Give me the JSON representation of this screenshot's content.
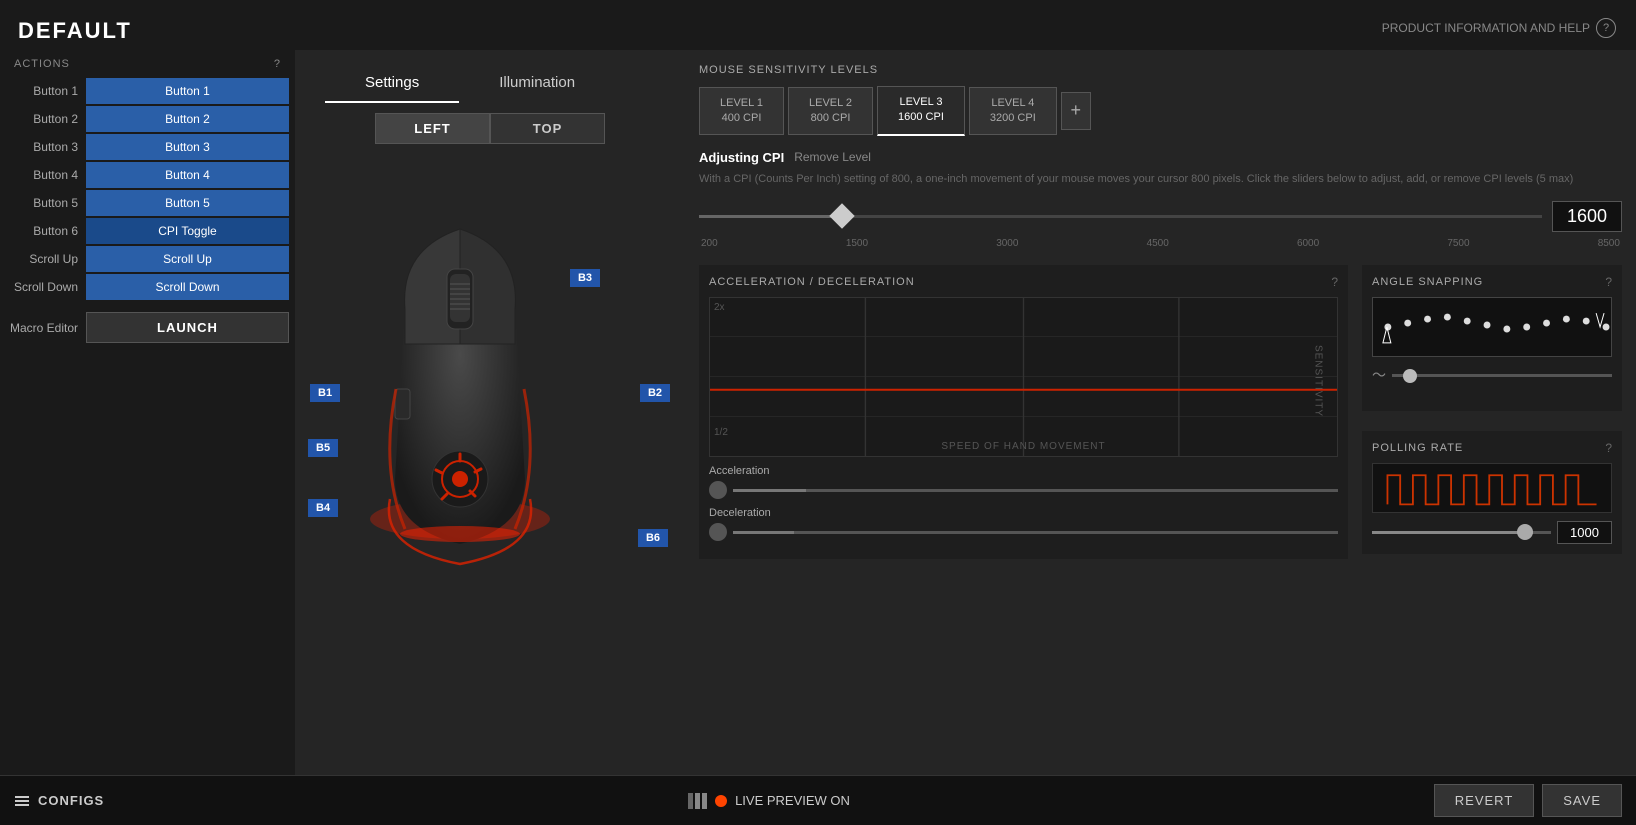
{
  "app": {
    "title": "DEFAULT",
    "product_info": "PRODUCT INFORMATION AND HELP"
  },
  "left_panel": {
    "section_title": "ACTIONS",
    "help": "?",
    "buttons": [
      {
        "label": "Button 1",
        "action": "Button 1"
      },
      {
        "label": "Button 2",
        "action": "Button 2"
      },
      {
        "label": "Button 3",
        "action": "Button 3"
      },
      {
        "label": "Button 4",
        "action": "Button 4"
      },
      {
        "label": "Button 5",
        "action": "Button 5"
      },
      {
        "label": "Button 6",
        "action": "CPI Toggle"
      },
      {
        "label": "Scroll Up",
        "action": "Scroll Up"
      },
      {
        "label": "Scroll Down",
        "action": "Scroll Down"
      }
    ],
    "macro_label": "Macro Editor",
    "launch_label": "LAUNCH"
  },
  "tabs": {
    "settings": "Settings",
    "illumination": "Illumination",
    "active": "settings"
  },
  "view_toggle": {
    "left": "LEFT",
    "top": "TOP",
    "active": "left"
  },
  "mouse_buttons": {
    "b1": "B1",
    "b2": "B2",
    "b3": "B3",
    "b4": "B4",
    "b5": "B5",
    "b6": "B6"
  },
  "sensitivity": {
    "section_title": "MOUSE SENSITIVITY LEVELS",
    "levels": [
      {
        "label": "LEVEL 1",
        "cpi": "400 CPI",
        "active": false
      },
      {
        "label": "LEVEL 2",
        "cpi": "800 CPI",
        "active": false
      },
      {
        "label": "LEVEL 3",
        "cpi": "1600 CPI",
        "active": true
      },
      {
        "label": "LEVEL 4",
        "cpi": "3200 CPI",
        "active": false
      }
    ],
    "add_label": "+",
    "adjusting_label": "Adjusting CPI",
    "remove_label": "Remove Level",
    "description": "With a CPI (Counts Per Inch) setting of 800, a one-inch movement of your mouse moves your cursor 800 pixels. Click the sliders below to adjust, add, or remove CPI levels (5 max)",
    "slider_min": "200",
    "slider_marks": [
      "200",
      "1500",
      "3000",
      "4500",
      "6000",
      "7500",
      "8500"
    ],
    "current_value": "1600",
    "slider_position_pct": 17
  },
  "acceleration": {
    "title": "ACCELERATION / DECELERATION",
    "y_label": "2x",
    "x_label": "SPEED OF HAND MOVEMENT",
    "sensitivity_label": "SENSITIVITY",
    "page": "1/2",
    "acceleration_label": "Acceleration",
    "deceleration_label": "Deceleration",
    "accel_position_pct": 12,
    "decel_position_pct": 10
  },
  "angle_snapping": {
    "title": "ANGLE SNAPPING",
    "slider_position_pct": 5
  },
  "polling_rate": {
    "title": "POLLING RATE",
    "value": "1000",
    "slider_position_pct": 90
  },
  "bottom_bar": {
    "configs_label": "CONFIGS",
    "live_preview_label": "LIVE PREVIEW ON",
    "revert_label": "REVERT",
    "save_label": "SAVE"
  }
}
